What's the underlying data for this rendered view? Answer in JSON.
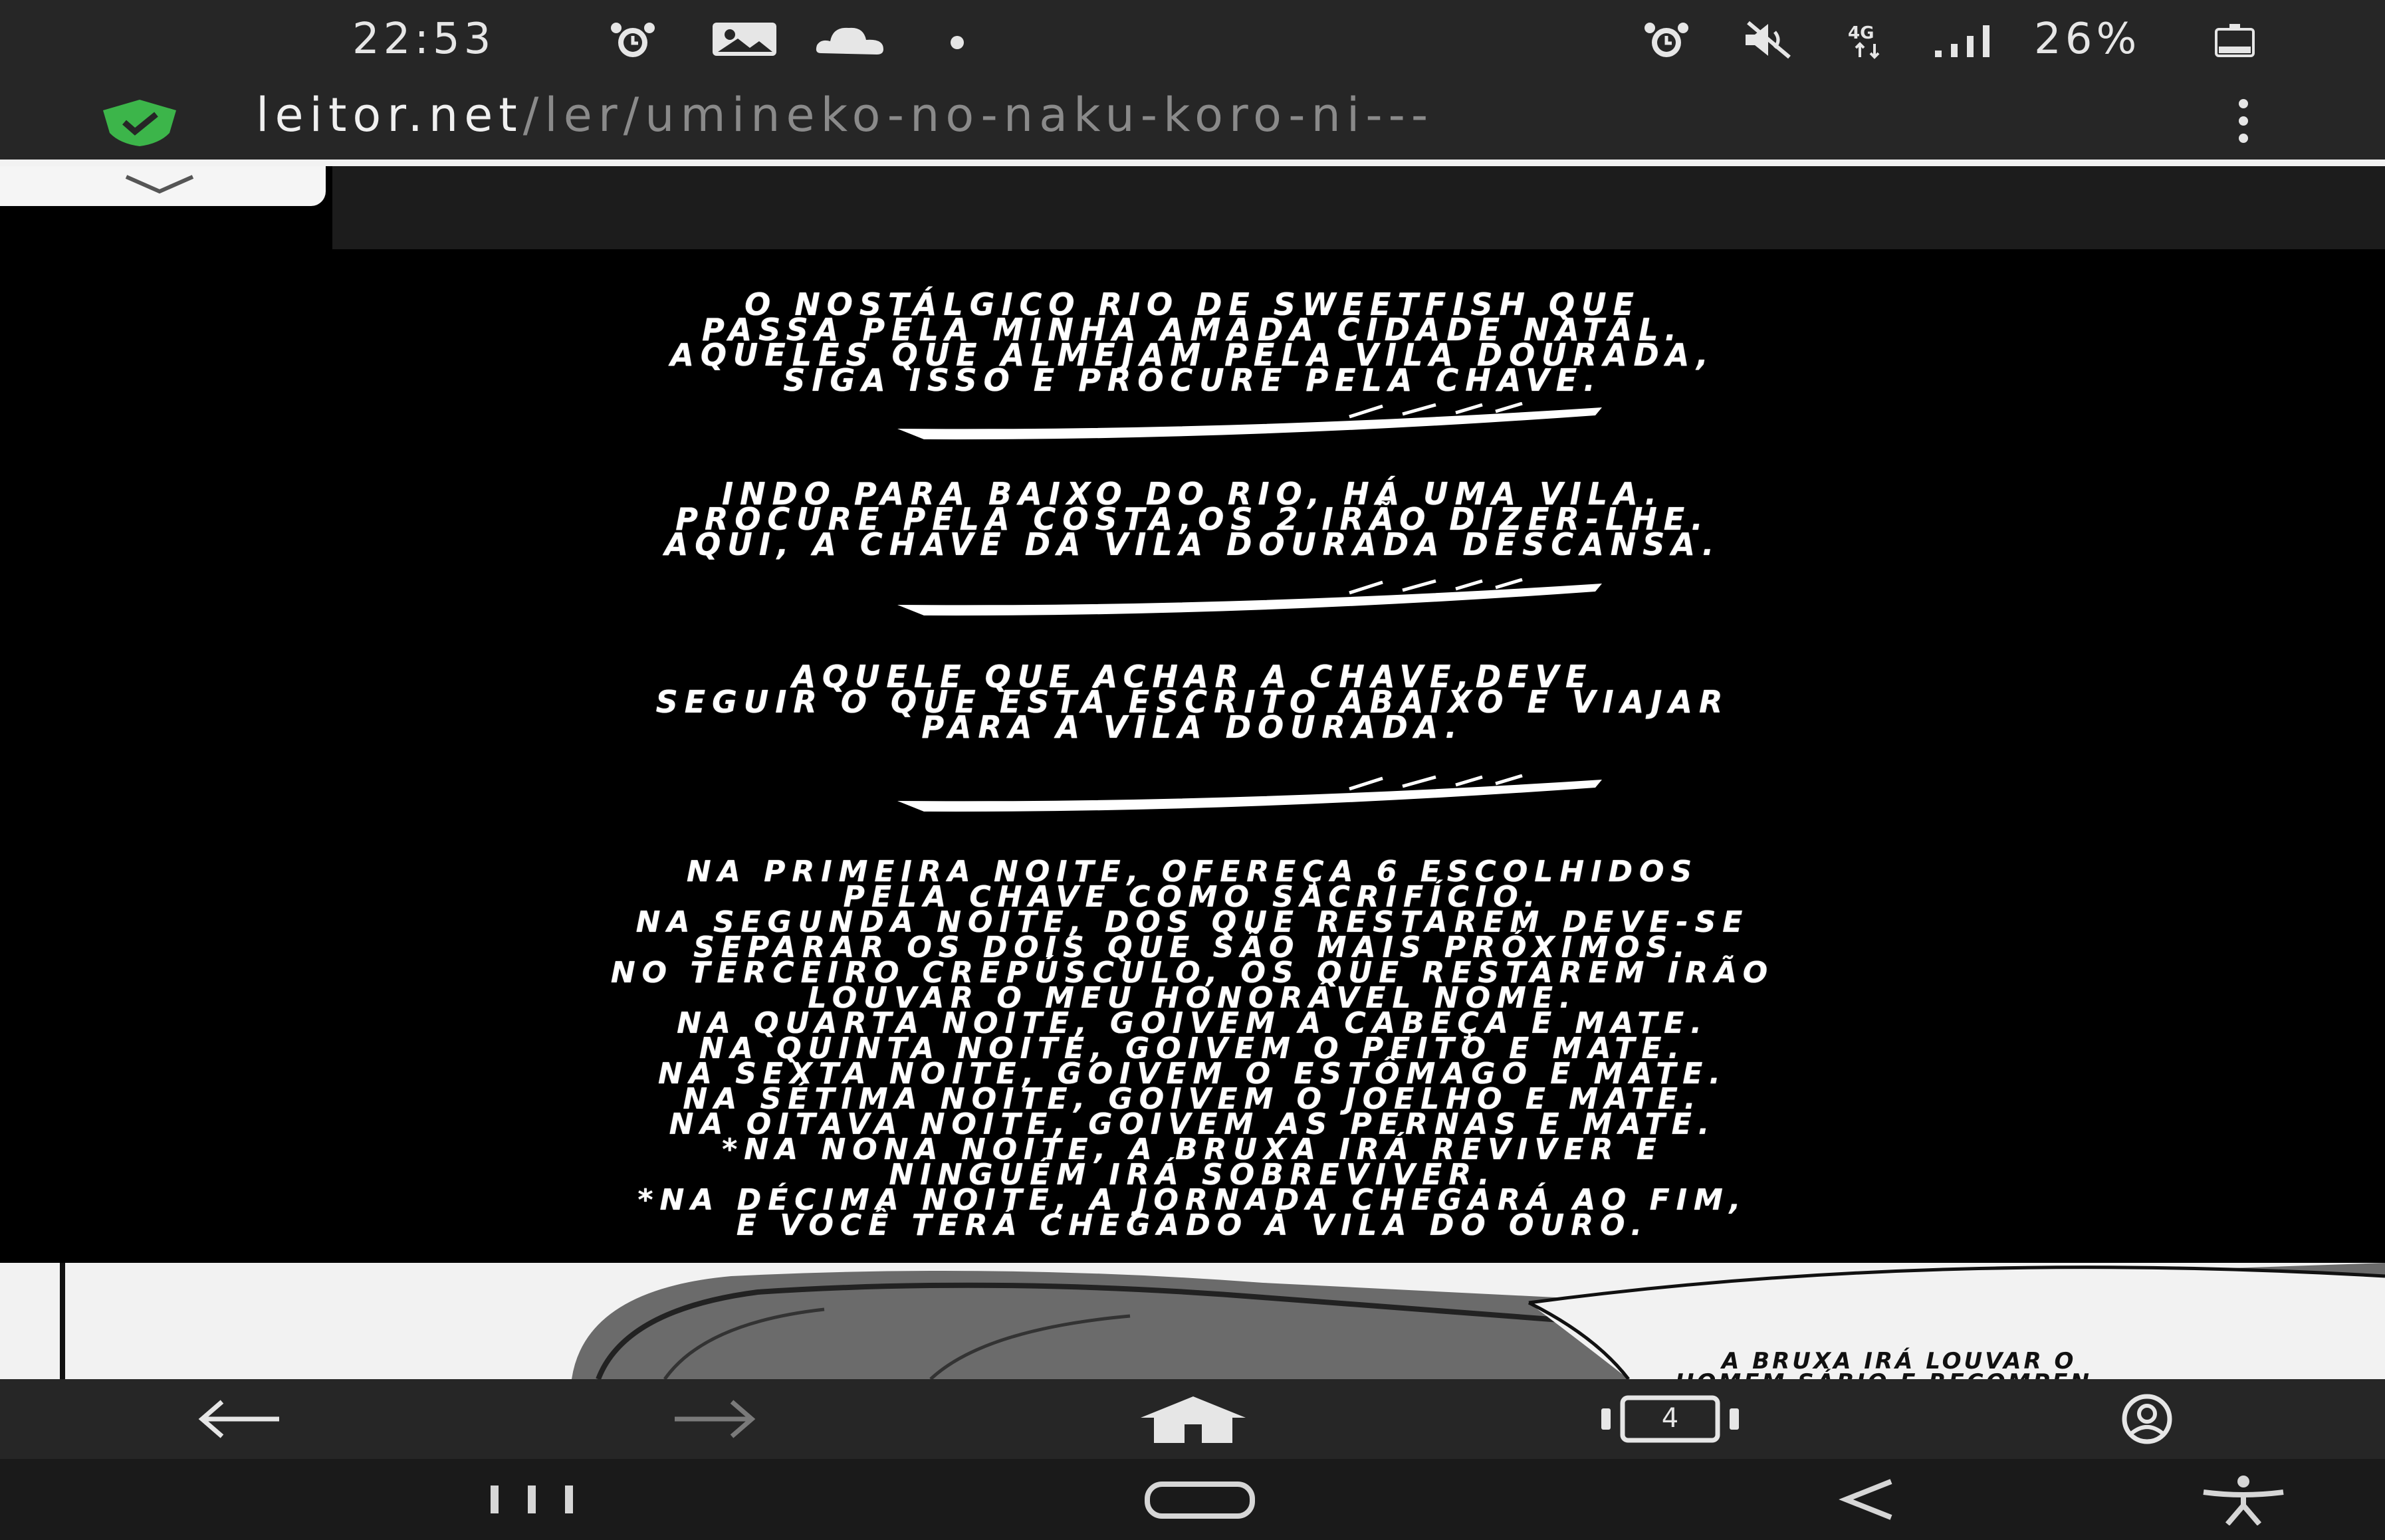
{
  "status_bar": {
    "time": "22:53",
    "battery_text": "26%",
    "icons_left": [
      "alarm-icon",
      "image-icon",
      "cloud-icon",
      "dot-icon"
    ],
    "icons_right": [
      "alarm-icon",
      "mute-icon",
      "4g-icon",
      "signal-icon",
      "battery-icon"
    ]
  },
  "url_bar": {
    "domain": "leitor.net",
    "path": "/ler/umineko-no-naku-koro-ni---",
    "secure_icon": "shield-check-icon",
    "menu_icon": "kebab-menu-icon",
    "secure_color": "#3cb54a"
  },
  "page": {
    "collapse_icon": "chevron-down-icon",
    "stanza1": [
      "O NOSTÁLGICO RIO DE SWEETFISH QUE",
      "PASSA PELA MINHA AMADA CIDADE NATAL.",
      "AQUELES QUE ALMEJAM PELA VILA DOURADA,",
      "SIGA ISSO E PROCURE PELA CHAVE."
    ],
    "stanza2": [
      "INDO PARA BAIXO DO RIO, HÁ UMA VILA.",
      "PROCURE PELA COSTA,OS 2 IRÃO DIZER-LHE.",
      "AQUI, A CHAVE DA VILA DOURADA DESCANSA."
    ],
    "stanza3": [
      "AQUELE QUE ACHAR A CHAVE,DEVE",
      "SEGUIR O QUE ESTÁ ESCRITO ABAIXO E VIAJAR",
      "PARA A VILA DOURADA."
    ],
    "stanza4": [
      "NA PRIMEIRA NOITE, OFEREÇA 6 ESCOLHIDOS",
      "PELA CHAVE COMO SACRIFÍCIO.",
      "NA SEGUNDA NOITE, DOS QUE RESTAREM DEVE-SE",
      "SEPARAR OS DOIS QUE SÃO MAIS PRÓXIMOS.",
      "NO TERCEIRO  CREPÚSCULO, OS QUE RESTAREM IRÃO",
      "LOUVAR O MEU HONORÁVEL NOME.",
      "NA QUARTA NOITE, GOIVEM A CABEÇA E MATE.",
      "NA QUINTA NOITE, GOIVEM O PEITO E MATE.",
      "NA SEXTA NOITE, GOIVEM O ESTÔMAGO E MATE.",
      "NA SÉTIMA NOITE, GOIVEM O JOELHO E MATE.",
      "NA OITAVA NOITE, GOIVEM AS PERNAS E MATE.",
      "*NA NONA NOITE, A BRUXA IRÁ REVIVER E",
      "NINGUÉM IRÁ SOBREVIVER.",
      "*NA DÉCIMA NOITE, A JORNADA CHEGARÁ AO FIM,",
      "E VOCÊ TERÁ CHEGADO À VILA DO OURO."
    ],
    "art_bubble": [
      "A BRUXA IRÁ LOUVAR O",
      "HOMEM SÁBIO E RECOMPEN-"
    ]
  },
  "browser_toolbar": {
    "back_icon": "arrow-left-icon",
    "forward_icon": "arrow-right-icon",
    "home_icon": "home-icon",
    "tabs_icon": "tabs-icon",
    "tabs_count": "4",
    "account_icon": "account-icon"
  },
  "system_nav": {
    "recents_icon": "recents-icon",
    "home_icon": "home-pill-icon",
    "back_icon": "back-chevron-icon",
    "accessibility_icon": "accessibility-icon"
  }
}
